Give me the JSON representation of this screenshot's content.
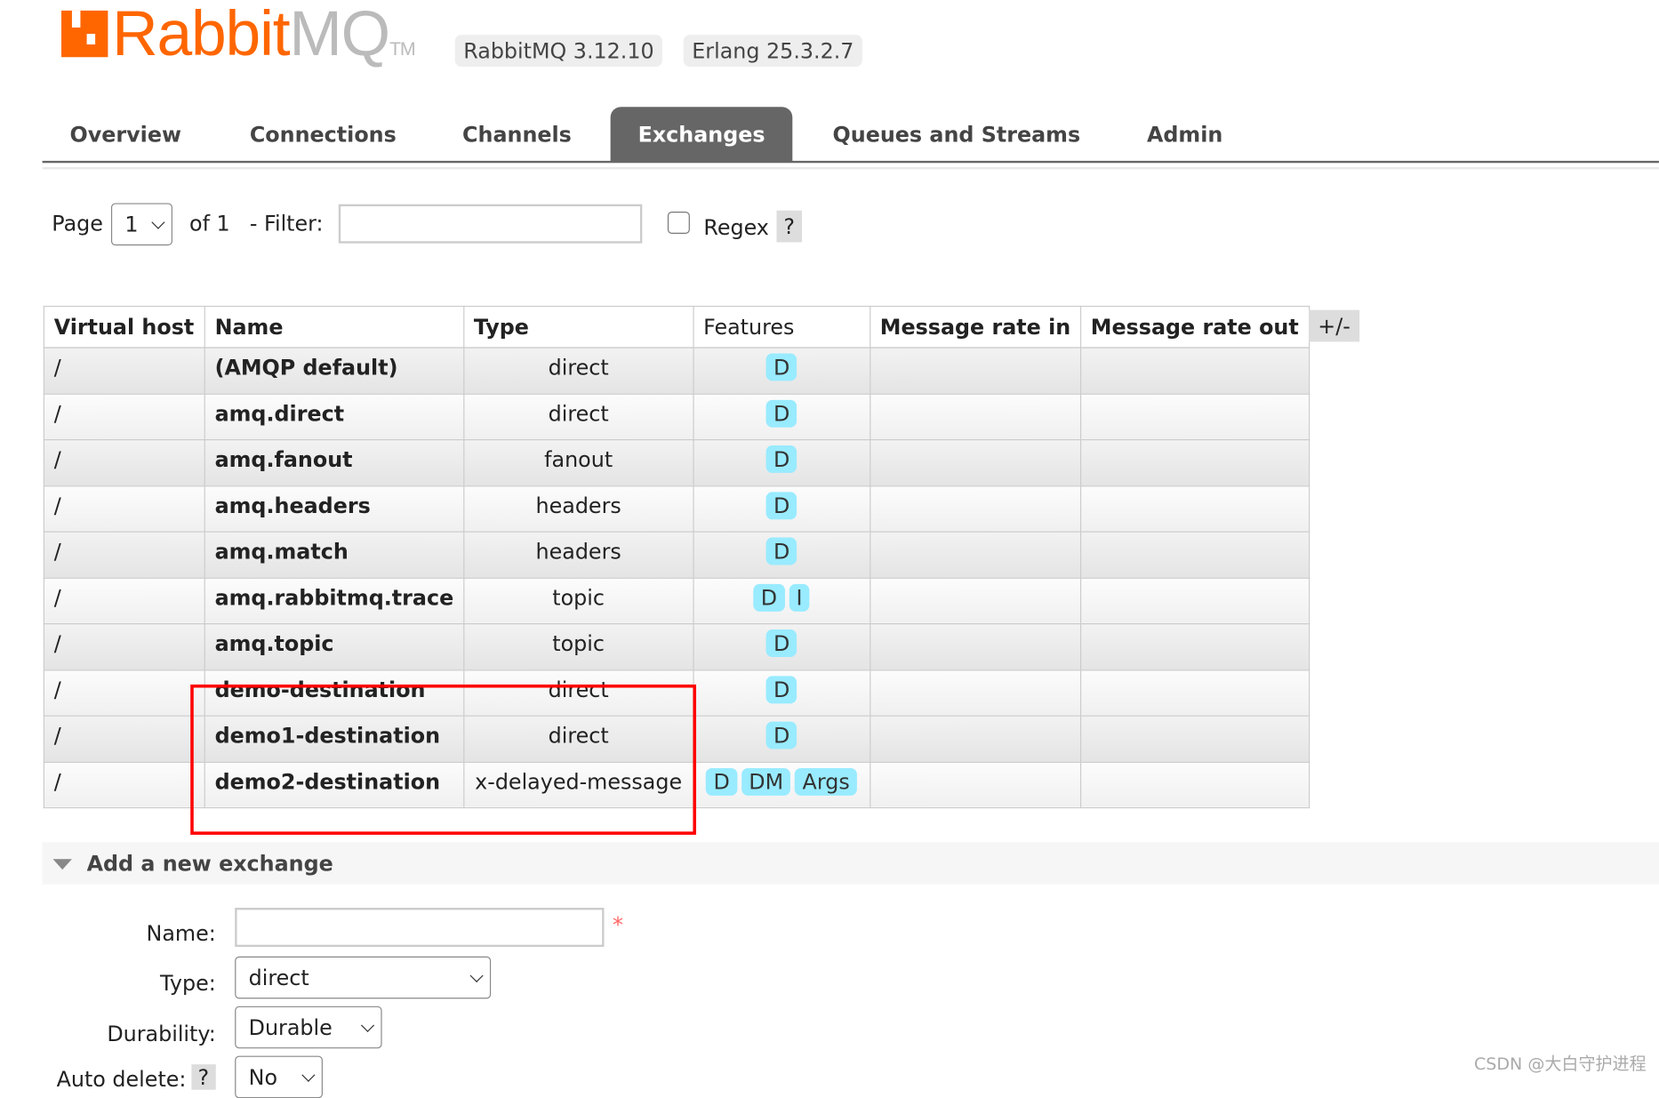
{
  "header": {
    "logo_text_orange": "Rabbit",
    "logo_text_gray": "MQ",
    "logo_tm": "TM",
    "version": "RabbitMQ 3.12.10",
    "erlang": "Erlang 25.3.2.7"
  },
  "tabs": [
    {
      "label": "Overview"
    },
    {
      "label": "Connections"
    },
    {
      "label": "Channels"
    },
    {
      "label": "Exchanges",
      "active": true
    },
    {
      "label": "Queues and Streams"
    },
    {
      "label": "Admin"
    }
  ],
  "pager": {
    "page_label": "Page",
    "page_value": "1",
    "of_label": "of 1",
    "filter_label": "- Filter:",
    "filter_value": "",
    "regex_label": "Regex",
    "regex_checked": false,
    "help": "?"
  },
  "table": {
    "columns": [
      "Virtual host",
      "Name",
      "Type",
      "Features",
      "Message rate in",
      "Message rate out"
    ],
    "toggle": "+/-",
    "rows": [
      {
        "vhost": "/",
        "name": "(AMQP default)",
        "type": "direct",
        "features": [
          "D"
        ]
      },
      {
        "vhost": "/",
        "name": "amq.direct",
        "type": "direct",
        "features": [
          "D"
        ]
      },
      {
        "vhost": "/",
        "name": "amq.fanout",
        "type": "fanout",
        "features": [
          "D"
        ]
      },
      {
        "vhost": "/",
        "name": "amq.headers",
        "type": "headers",
        "features": [
          "D"
        ]
      },
      {
        "vhost": "/",
        "name": "amq.match",
        "type": "headers",
        "features": [
          "D"
        ]
      },
      {
        "vhost": "/",
        "name": "amq.rabbitmq.trace",
        "type": "topic",
        "features": [
          "D",
          "I"
        ]
      },
      {
        "vhost": "/",
        "name": "amq.topic",
        "type": "topic",
        "features": [
          "D"
        ]
      },
      {
        "vhost": "/",
        "name": "demo-destination",
        "type": "direct",
        "features": [
          "D"
        ]
      },
      {
        "vhost": "/",
        "name": "demo1-destination",
        "type": "direct",
        "features": [
          "D"
        ]
      },
      {
        "vhost": "/",
        "name": "demo2-destination",
        "type": "x-delayed-message",
        "features": [
          "D",
          "DM",
          "Args"
        ]
      }
    ],
    "highlight_color": "#ff0000",
    "feature_badge_color": "#99ebff"
  },
  "add_exchange": {
    "title": "Add a new exchange",
    "name_label": "Name:",
    "name_value": "",
    "required_mark": "*",
    "type_label": "Type:",
    "type_value": "direct",
    "durability_label": "Durability:",
    "durability_value": "Durable",
    "auto_delete_label": "Auto delete:",
    "auto_delete_help": "?",
    "auto_delete_value": "No"
  },
  "watermark": "CSDN @大白守护进程",
  "colors": {
    "brand": "#ff6600",
    "active_tab": "#666666"
  }
}
